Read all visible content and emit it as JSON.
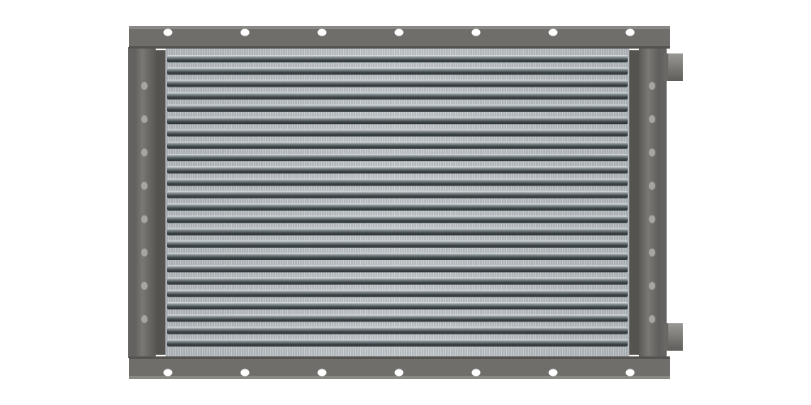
{
  "scene": {
    "subject": "heat-exchanger-coil",
    "background_color": "#ffffff",
    "frame_color": "#6f6d6a",
    "frame_shadow_color": "#4f4d4b",
    "frame_highlight_color": "#8c8a87",
    "fin_color": "#b8bec2",
    "tube_color": "#3b4346",
    "tube_highlight_color": "#d9dde0",
    "hole_color": "#ffffff",
    "header_pipe_color": "#858380",
    "flange_hole_count": 7,
    "side_hole_count": 8,
    "tube_row_count": 24,
    "header_pipe_count": 2
  }
}
